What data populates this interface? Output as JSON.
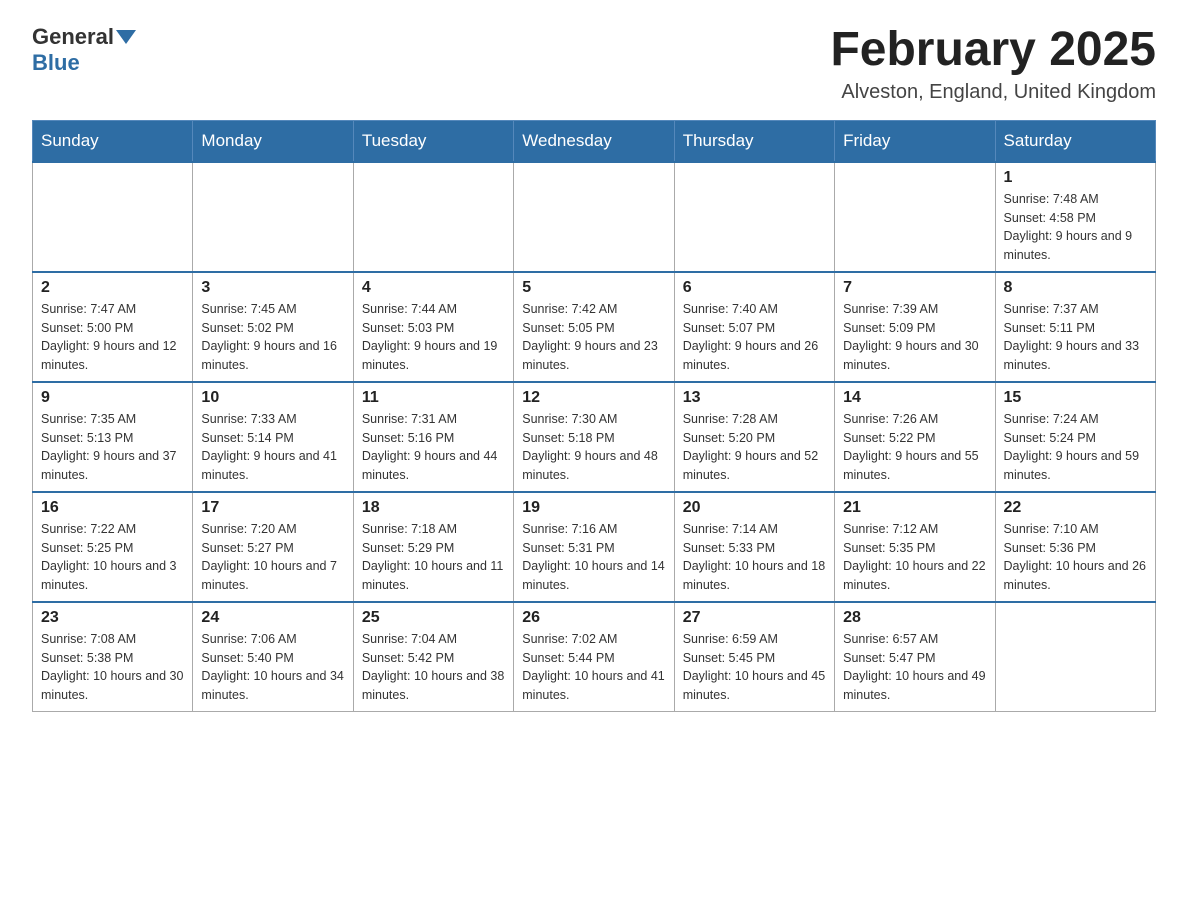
{
  "header": {
    "logo_general": "General",
    "logo_blue": "Blue",
    "month_title": "February 2025",
    "location": "Alveston, England, United Kingdom"
  },
  "days_of_week": [
    "Sunday",
    "Monday",
    "Tuesday",
    "Wednesday",
    "Thursday",
    "Friday",
    "Saturday"
  ],
  "weeks": [
    {
      "days": [
        {
          "number": "",
          "sunrise": "",
          "sunset": "",
          "daylight": ""
        },
        {
          "number": "",
          "sunrise": "",
          "sunset": "",
          "daylight": ""
        },
        {
          "number": "",
          "sunrise": "",
          "sunset": "",
          "daylight": ""
        },
        {
          "number": "",
          "sunrise": "",
          "sunset": "",
          "daylight": ""
        },
        {
          "number": "",
          "sunrise": "",
          "sunset": "",
          "daylight": ""
        },
        {
          "number": "",
          "sunrise": "",
          "sunset": "",
          "daylight": ""
        },
        {
          "number": "1",
          "sunrise": "Sunrise: 7:48 AM",
          "sunset": "Sunset: 4:58 PM",
          "daylight": "Daylight: 9 hours and 9 minutes."
        }
      ]
    },
    {
      "days": [
        {
          "number": "2",
          "sunrise": "Sunrise: 7:47 AM",
          "sunset": "Sunset: 5:00 PM",
          "daylight": "Daylight: 9 hours and 12 minutes."
        },
        {
          "number": "3",
          "sunrise": "Sunrise: 7:45 AM",
          "sunset": "Sunset: 5:02 PM",
          "daylight": "Daylight: 9 hours and 16 minutes."
        },
        {
          "number": "4",
          "sunrise": "Sunrise: 7:44 AM",
          "sunset": "Sunset: 5:03 PM",
          "daylight": "Daylight: 9 hours and 19 minutes."
        },
        {
          "number": "5",
          "sunrise": "Sunrise: 7:42 AM",
          "sunset": "Sunset: 5:05 PM",
          "daylight": "Daylight: 9 hours and 23 minutes."
        },
        {
          "number": "6",
          "sunrise": "Sunrise: 7:40 AM",
          "sunset": "Sunset: 5:07 PM",
          "daylight": "Daylight: 9 hours and 26 minutes."
        },
        {
          "number": "7",
          "sunrise": "Sunrise: 7:39 AM",
          "sunset": "Sunset: 5:09 PM",
          "daylight": "Daylight: 9 hours and 30 minutes."
        },
        {
          "number": "8",
          "sunrise": "Sunrise: 7:37 AM",
          "sunset": "Sunset: 5:11 PM",
          "daylight": "Daylight: 9 hours and 33 minutes."
        }
      ]
    },
    {
      "days": [
        {
          "number": "9",
          "sunrise": "Sunrise: 7:35 AM",
          "sunset": "Sunset: 5:13 PM",
          "daylight": "Daylight: 9 hours and 37 minutes."
        },
        {
          "number": "10",
          "sunrise": "Sunrise: 7:33 AM",
          "sunset": "Sunset: 5:14 PM",
          "daylight": "Daylight: 9 hours and 41 minutes."
        },
        {
          "number": "11",
          "sunrise": "Sunrise: 7:31 AM",
          "sunset": "Sunset: 5:16 PM",
          "daylight": "Daylight: 9 hours and 44 minutes."
        },
        {
          "number": "12",
          "sunrise": "Sunrise: 7:30 AM",
          "sunset": "Sunset: 5:18 PM",
          "daylight": "Daylight: 9 hours and 48 minutes."
        },
        {
          "number": "13",
          "sunrise": "Sunrise: 7:28 AM",
          "sunset": "Sunset: 5:20 PM",
          "daylight": "Daylight: 9 hours and 52 minutes."
        },
        {
          "number": "14",
          "sunrise": "Sunrise: 7:26 AM",
          "sunset": "Sunset: 5:22 PM",
          "daylight": "Daylight: 9 hours and 55 minutes."
        },
        {
          "number": "15",
          "sunrise": "Sunrise: 7:24 AM",
          "sunset": "Sunset: 5:24 PM",
          "daylight": "Daylight: 9 hours and 59 minutes."
        }
      ]
    },
    {
      "days": [
        {
          "number": "16",
          "sunrise": "Sunrise: 7:22 AM",
          "sunset": "Sunset: 5:25 PM",
          "daylight": "Daylight: 10 hours and 3 minutes."
        },
        {
          "number": "17",
          "sunrise": "Sunrise: 7:20 AM",
          "sunset": "Sunset: 5:27 PM",
          "daylight": "Daylight: 10 hours and 7 minutes."
        },
        {
          "number": "18",
          "sunrise": "Sunrise: 7:18 AM",
          "sunset": "Sunset: 5:29 PM",
          "daylight": "Daylight: 10 hours and 11 minutes."
        },
        {
          "number": "19",
          "sunrise": "Sunrise: 7:16 AM",
          "sunset": "Sunset: 5:31 PM",
          "daylight": "Daylight: 10 hours and 14 minutes."
        },
        {
          "number": "20",
          "sunrise": "Sunrise: 7:14 AM",
          "sunset": "Sunset: 5:33 PM",
          "daylight": "Daylight: 10 hours and 18 minutes."
        },
        {
          "number": "21",
          "sunrise": "Sunrise: 7:12 AM",
          "sunset": "Sunset: 5:35 PM",
          "daylight": "Daylight: 10 hours and 22 minutes."
        },
        {
          "number": "22",
          "sunrise": "Sunrise: 7:10 AM",
          "sunset": "Sunset: 5:36 PM",
          "daylight": "Daylight: 10 hours and 26 minutes."
        }
      ]
    },
    {
      "days": [
        {
          "number": "23",
          "sunrise": "Sunrise: 7:08 AM",
          "sunset": "Sunset: 5:38 PM",
          "daylight": "Daylight: 10 hours and 30 minutes."
        },
        {
          "number": "24",
          "sunrise": "Sunrise: 7:06 AM",
          "sunset": "Sunset: 5:40 PM",
          "daylight": "Daylight: 10 hours and 34 minutes."
        },
        {
          "number": "25",
          "sunrise": "Sunrise: 7:04 AM",
          "sunset": "Sunset: 5:42 PM",
          "daylight": "Daylight: 10 hours and 38 minutes."
        },
        {
          "number": "26",
          "sunrise": "Sunrise: 7:02 AM",
          "sunset": "Sunset: 5:44 PM",
          "daylight": "Daylight: 10 hours and 41 minutes."
        },
        {
          "number": "27",
          "sunrise": "Sunrise: 6:59 AM",
          "sunset": "Sunset: 5:45 PM",
          "daylight": "Daylight: 10 hours and 45 minutes."
        },
        {
          "number": "28",
          "sunrise": "Sunrise: 6:57 AM",
          "sunset": "Sunset: 5:47 PM",
          "daylight": "Daylight: 10 hours and 49 minutes."
        },
        {
          "number": "",
          "sunrise": "",
          "sunset": "",
          "daylight": ""
        }
      ]
    }
  ]
}
